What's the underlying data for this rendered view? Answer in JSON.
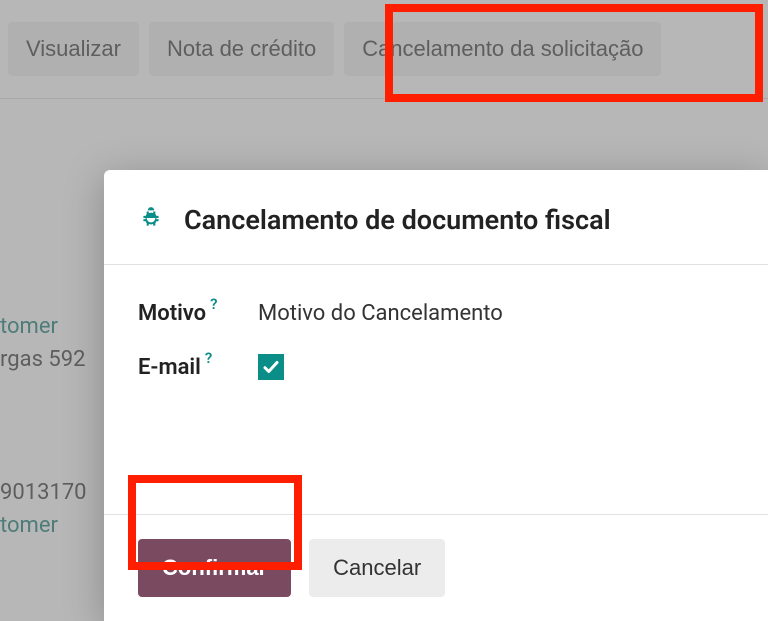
{
  "toolbar": {
    "view_label": "Visualizar",
    "credit_note_label": "Nota de crédito",
    "cancel_request_label": "Cancelamento da solicitação"
  },
  "background": {
    "customer_fragment_1": "tomer",
    "address_fragment": "rgas 592",
    "number_fragment": "9013170",
    "customer_fragment_2": "tomer"
  },
  "modal": {
    "title": "Cancelamento de documento fiscal",
    "reason_label": "Motivo",
    "reason_value": "Motivo do Cancelamento",
    "email_label": "E-mail",
    "email_checked": true,
    "help_tooltip": "?",
    "confirm_label": "Confirmar",
    "cancel_label": "Cancelar"
  }
}
